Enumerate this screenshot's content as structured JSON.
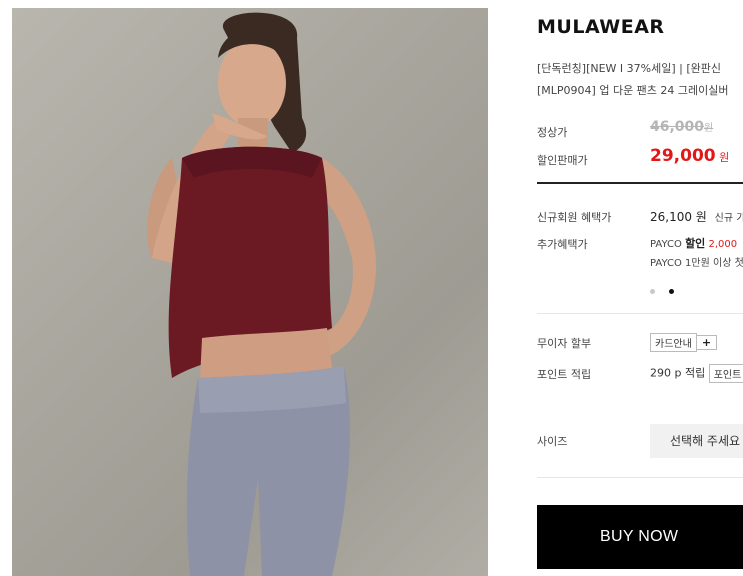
{
  "product": {
    "brand": "MULAWEAR",
    "name_line1": "[단독런칭][NEW I 37%세일] | [완판신",
    "name_line2": "[MLP0904] 업 다운 팬츠 24 그레이실버"
  },
  "price": {
    "regular_label": "정상가",
    "regular_value": "46,000",
    "regular_unit": "원",
    "sale_label": "할인판매가",
    "sale_value": "29,000",
    "sale_unit": "원"
  },
  "benefits": {
    "new_member_label": "신규회원 혜택가",
    "new_member_value": "26,100 원",
    "new_member_note": "신규 가",
    "extra_label": "추가혜택가",
    "payco_prefix": "PAYCO",
    "payco_discount": "할인",
    "payco_amount": "2,000",
    "payco_line2": "PAYCO 1만원 이상 첫"
  },
  "installment": {
    "label": "무이자 할부",
    "card_button": "카드안내",
    "plus": "+"
  },
  "points": {
    "label": "포인트 적립",
    "value": "290 p 적립",
    "button": "포인트"
  },
  "size": {
    "label": "사이즈",
    "placeholder": "선택해 주세요"
  },
  "buy_button": "BUY NOW",
  "carousel": {
    "active_index": 1,
    "count": 2
  },
  "colors": {
    "sale_red": "#e21818",
    "buy_bg": "#000000",
    "top_color": "#6b1a24",
    "pants_color": "#8e92a6"
  }
}
